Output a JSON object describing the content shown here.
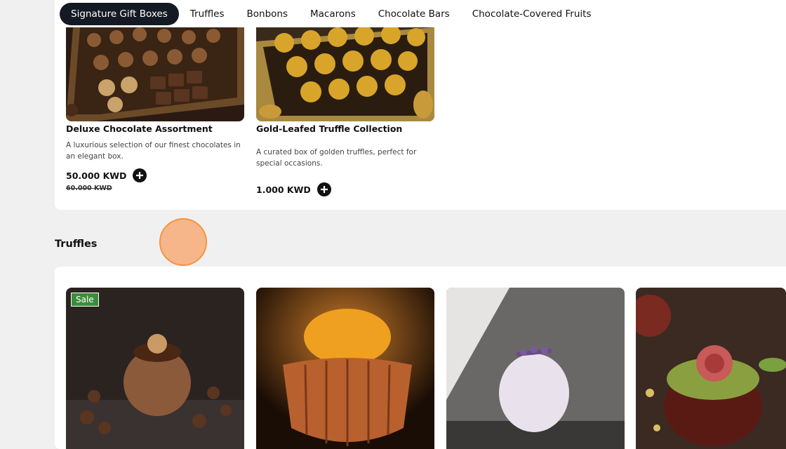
{
  "nav": {
    "items": [
      {
        "label": "Signature Gift Boxes",
        "active": true
      },
      {
        "label": "Truffles"
      },
      {
        "label": "Bonbons"
      },
      {
        "label": "Macarons"
      },
      {
        "label": "Chocolate Bars"
      },
      {
        "label": "Chocolate-Covered Fruits"
      }
    ]
  },
  "gift_boxes": {
    "products": [
      {
        "title": "Deluxe Chocolate Assortment",
        "description": "A luxurious selection of our finest chocolates in an elegant box.",
        "price": "50.000 KWD",
        "old_price": "60.000 KWD"
      },
      {
        "title": "Gold-Leafed Truffle Collection",
        "description": "A curated box of golden truffles, perfect for special occasions.",
        "price": "1.000 KWD"
      }
    ]
  },
  "truffles": {
    "title": "Truffles",
    "badge": "Sale"
  },
  "colors": {
    "nav_active_bg": "#141a24",
    "sale_badge": "#3d8c3d",
    "cursor_highlight": "#f3953f"
  },
  "icons": {
    "add": "plus-circle-icon"
  }
}
